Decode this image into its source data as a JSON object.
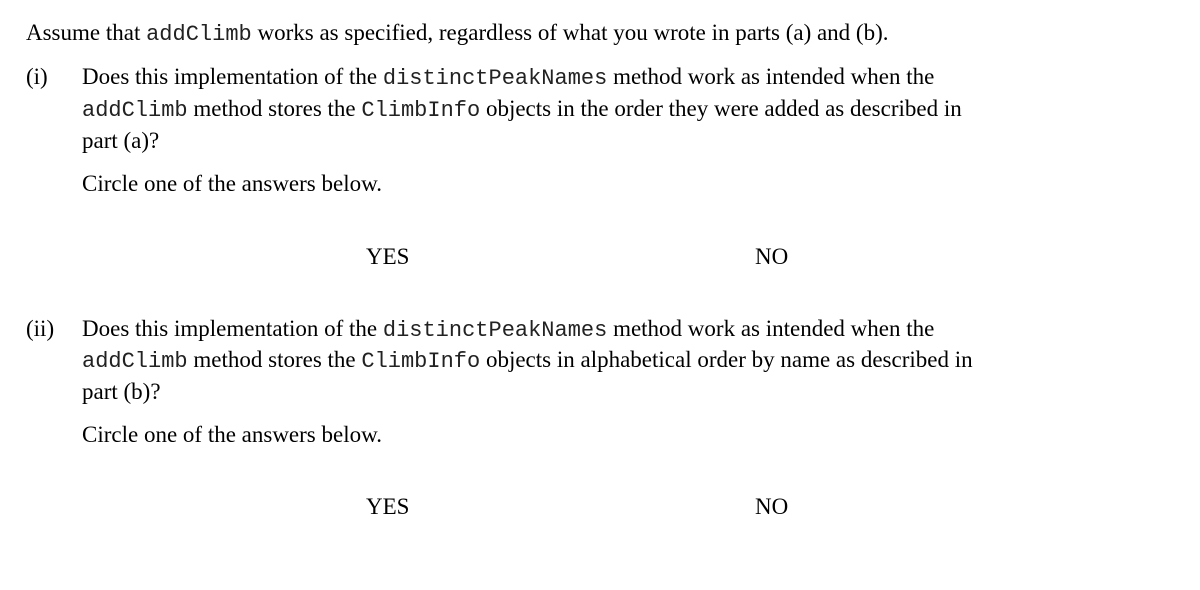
{
  "intro": {
    "a": "Assume that ",
    "code": "addClimb",
    "b": " works as specified, regardless of what you wrote in parts (a) and (b)."
  },
  "q1": {
    "num": "(i)",
    "l1a": "Does this implementation of the ",
    "l1code": "distinctPeakNames",
    "l1b": " method work as intended when the",
    "l2code": "addClimb",
    "l2a": " method stores the ",
    "l2code2": "ClimbInfo",
    "l2b": " objects in the order they were added as described in",
    "l3": "part (a)?",
    "circle": "Circle one of the answers below.",
    "yes": "YES",
    "no": "NO"
  },
  "q2": {
    "num": "(ii)",
    "l1a": "Does this implementation of the ",
    "l1code": "distinctPeakNames",
    "l1b": " method work as intended when the",
    "l2code": "addClimb",
    "l2a": " method stores the ",
    "l2code2": "ClimbInfo",
    "l2b": " objects in alphabetical order by name as described in",
    "l3": "part (b)?",
    "circle": "Circle one of the answers below.",
    "yes": "YES",
    "no": "NO"
  }
}
